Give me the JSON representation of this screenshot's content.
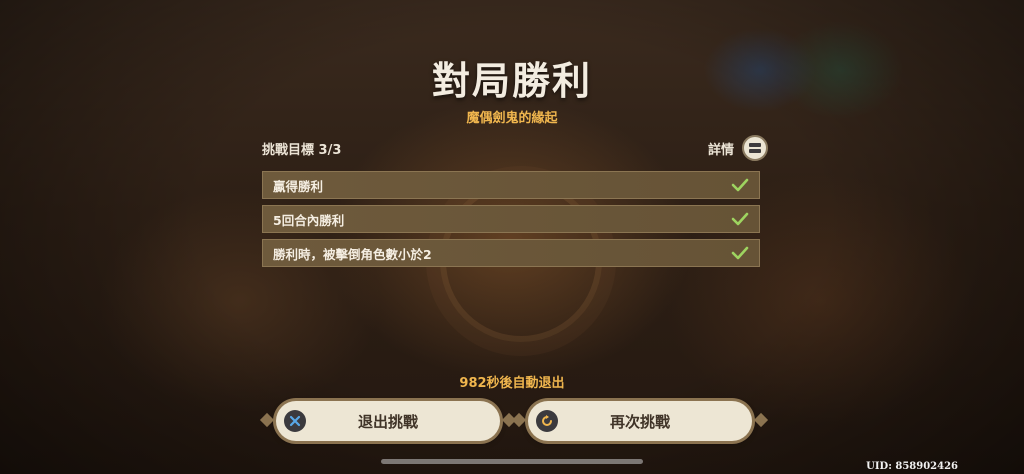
{
  "result": {
    "title": "對局勝利",
    "subtitle": "魔偶劍鬼的緣起"
  },
  "challenge": {
    "header_label": "挑戰目標 3/3",
    "details_label": "詳情",
    "details_icon": "book-icon",
    "tasks": [
      {
        "label": "贏得勝利",
        "completed": true
      },
      {
        "label": "5回合內勝利",
        "completed": true
      },
      {
        "label": "勝利時，被擊倒角色數小於2",
        "completed": true
      }
    ],
    "check_color": "#9ed460"
  },
  "countdown": "982秒後自動退出",
  "buttons": {
    "exit_label": "退出挑戰",
    "exit_icon": "close-icon",
    "retry_label": "再次挑戰",
    "retry_icon": "retry-icon",
    "accent_color": "#f0b64e"
  },
  "uid": "UID: 858902426"
}
